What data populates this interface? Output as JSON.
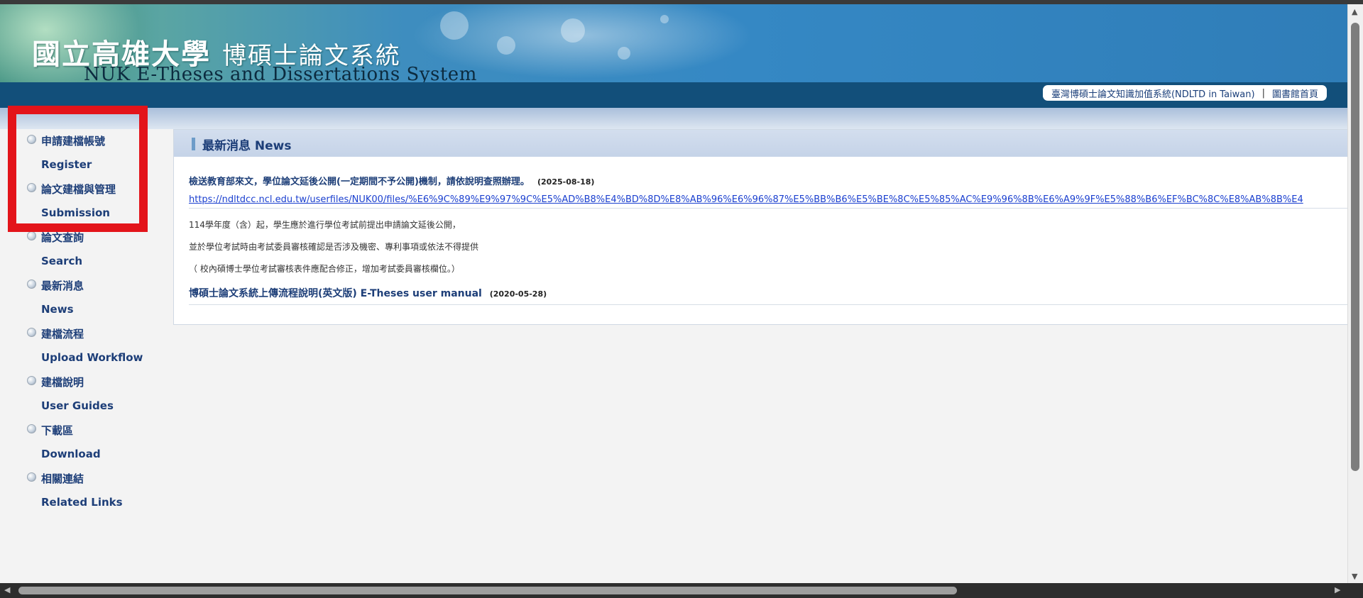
{
  "banner": {
    "title_cn_main": "國立高雄大學",
    "title_cn_sub": "博碩士論文系統",
    "title_en": "NUK E-Theses and Dissertations System"
  },
  "toplinks": {
    "ndltd": "臺灣博碩士論文知識加值系統(NDLTD in Taiwan)",
    "separator": "|",
    "library": "圖書館首頁"
  },
  "sidebar": {
    "items": [
      {
        "cn": "申請建檔帳號",
        "en": "Register"
      },
      {
        "cn": "論文建檔與管理",
        "en": "Submission"
      },
      {
        "cn": "論文查詢",
        "en": "Search"
      },
      {
        "cn": "最新消息",
        "en": "News"
      },
      {
        "cn": "建檔流程",
        "en": "Upload Workflow"
      },
      {
        "cn": "建檔說明",
        "en": "User Guides"
      },
      {
        "cn": "下載區",
        "en": "Download"
      },
      {
        "cn": "相關連結",
        "en": "Related Links"
      }
    ]
  },
  "news": {
    "header": "最新消息 News",
    "items": [
      {
        "title": "檢送教育部來文，學位論文延後公開(一定期間不予公開)機制，請依說明查照辦理。",
        "date": "(2025-08-18)",
        "url": "https://ndltdcc.ncl.edu.tw/userfiles/NUK00/files/%E6%9C%89%E9%97%9C%E5%AD%B8%E4%BD%8D%E8%AB%96%E6%96%87%E5%BB%B6%E5%BE%8C%E5%85%AC%E9%96%8B%E6%A9%9F%E5%88%B6%EF%BC%8C%E8%AB%8B%E4",
        "lines": [
          "114學年度（含）起，學生應於進行學位考試前提出申請論文延後公開，",
          "並於學位考試時由考試委員審核確認是否涉及機密、專利事項或依法不得提供",
          "（ 校內碩博士學位考試審核表件應配合修正，增加考試委員審核欄位。）"
        ]
      },
      {
        "title": "博碩士論文系統上傳流程說明(英文版) E-Theses user manual",
        "date": "(2020-05-28)"
      }
    ]
  },
  "scrollbars": {
    "up_arrow": "▲",
    "down_arrow": "▼",
    "left_arrow": "◀",
    "right_arrow": "▶"
  }
}
